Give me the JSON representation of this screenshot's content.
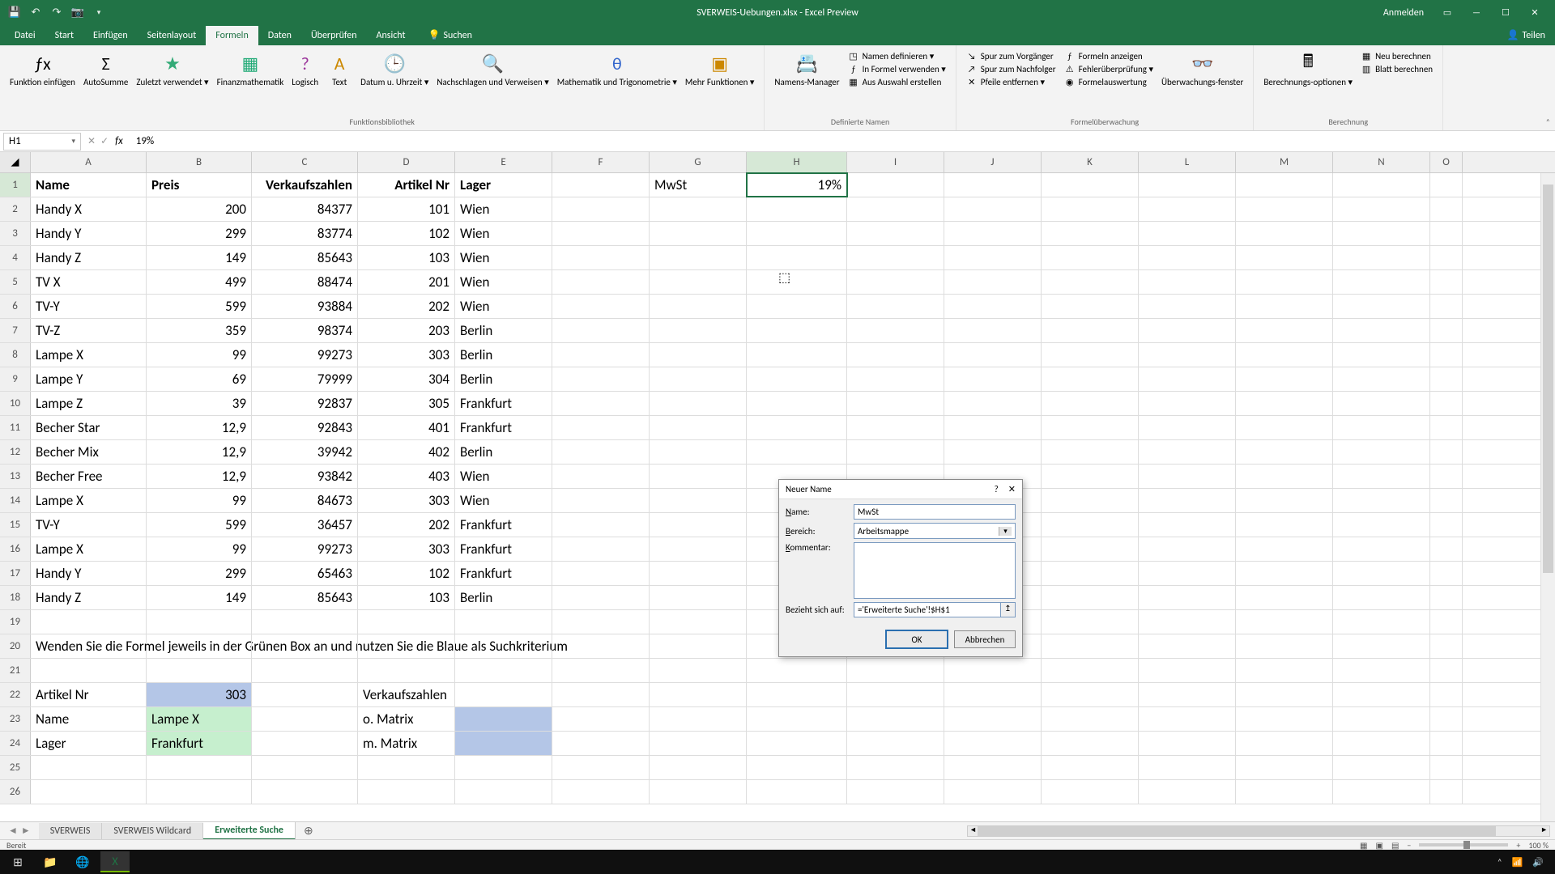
{
  "titlebar": {
    "title": "SVERWEIS-Uebungen.xlsx - Excel Preview",
    "signin": "Anmelden"
  },
  "menu": {
    "tabs": [
      "Datei",
      "Start",
      "Einfügen",
      "Seitenlayout",
      "Formeln",
      "Daten",
      "Überprüfen",
      "Ansicht"
    ],
    "search_placeholder": "Suchen",
    "share": "Teilen"
  },
  "ribbon": {
    "groups": {
      "funcbib": {
        "label": "Funktionsbibliothek",
        "buttons": [
          "Funktion einfügen",
          "AutoSumme",
          "Zuletzt verwendet ▾",
          "Finanzmathematik",
          "Logisch",
          "Text",
          "Datum u. Uhrzeit ▾",
          "Nachschlagen und Verweisen ▾",
          "Mathematik und Trigonometrie ▾",
          "Mehr Funktionen ▾"
        ]
      },
      "defnames": {
        "label": "Definierte Namen",
        "big": "Namens-Manager",
        "items": [
          "Namen definieren ▾",
          "In Formel verwenden ▾",
          "Aus Auswahl erstellen"
        ]
      },
      "audit": {
        "label": "Formelüberwachung",
        "items_left": [
          "Spur zum Vorgänger",
          "Spur zum Nachfolger",
          "Pfeile entfernen ▾"
        ],
        "items_right": [
          "Formeln anzeigen",
          "Fehlerüberprüfung ▾",
          "Formelauswertung"
        ],
        "watch": "Überwachungs-fenster"
      },
      "calc": {
        "label": "Berechnung",
        "big": "Berechnungs-optionen ▾",
        "items": [
          "Neu berechnen",
          "Blatt berechnen"
        ]
      }
    }
  },
  "formula_bar": {
    "namebox": "H1",
    "formula": "19%"
  },
  "columns": [
    "A",
    "B",
    "C",
    "D",
    "E",
    "F",
    "G",
    "H",
    "I",
    "J",
    "K",
    "L",
    "M",
    "N",
    "O"
  ],
  "headers": {
    "A": "Name",
    "B": "Preis",
    "C": "Verkaufszahlen",
    "D": "Artikel Nr",
    "E": "Lager",
    "G": "MwSt",
    "H": "19%"
  },
  "data_rows": [
    {
      "A": "Handy X",
      "B": "200",
      "C": "84377",
      "D": "101",
      "E": "Wien"
    },
    {
      "A": "Handy Y",
      "B": "299",
      "C": "83774",
      "D": "102",
      "E": "Wien"
    },
    {
      "A": "Handy Z",
      "B": "149",
      "C": "85643",
      "D": "103",
      "E": "Wien"
    },
    {
      "A": "TV X",
      "B": "499",
      "C": "88474",
      "D": "201",
      "E": "Wien"
    },
    {
      "A": "TV-Y",
      "B": "599",
      "C": "93884",
      "D": "202",
      "E": "Wien"
    },
    {
      "A": "TV-Z",
      "B": "359",
      "C": "98374",
      "D": "203",
      "E": "Berlin"
    },
    {
      "A": "Lampe X",
      "B": "99",
      "C": "99273",
      "D": "303",
      "E": "Berlin"
    },
    {
      "A": "Lampe Y",
      "B": "69",
      "C": "79999",
      "D": "304",
      "E": "Berlin"
    },
    {
      "A": "Lampe Z",
      "B": "39",
      "C": "92837",
      "D": "305",
      "E": "Frankfurt"
    },
    {
      "A": "Becher Star",
      "B": "12,9",
      "C": "92843",
      "D": "401",
      "E": "Frankfurt"
    },
    {
      "A": "Becher Mix",
      "B": "12,9",
      "C": "39942",
      "D": "402",
      "E": "Berlin"
    },
    {
      "A": "Becher Free",
      "B": "12,9",
      "C": "93842",
      "D": "403",
      "E": "Wien"
    },
    {
      "A": "Lampe X",
      "B": "99",
      "C": "84673",
      "D": "303",
      "E": "Wien"
    },
    {
      "A": "TV-Y",
      "B": "599",
      "C": "36457",
      "D": "202",
      "E": "Frankfurt"
    },
    {
      "A": "Lampe X",
      "B": "99",
      "C": "99273",
      "D": "303",
      "E": "Frankfurt"
    },
    {
      "A": "Handy Y",
      "B": "299",
      "C": "65463",
      "D": "102",
      "E": "Frankfurt"
    },
    {
      "A": "Handy Z",
      "B": "149",
      "C": "85643",
      "D": "103",
      "E": "Berlin"
    }
  ],
  "row20": "Wenden Sie die Formel jeweils in der Grünen Box an und nutzen Sie die Blaue als Suchkriterium",
  "lookup": {
    "r22": {
      "A": "Artikel Nr",
      "B": "303",
      "D": "Verkaufszahlen"
    },
    "r23": {
      "A": "Name",
      "B": "Lampe X",
      "D": "o. Matrix"
    },
    "r24": {
      "A": "Lager",
      "B": "Frankfurt",
      "D": "m. Matrix"
    }
  },
  "sheets": [
    "SVERWEIS",
    "SVERWEIS Wildcard",
    "Erweiterte Suche"
  ],
  "status": {
    "ready": "Bereit",
    "zoom": "100 %"
  },
  "dialog": {
    "title": "Neuer Name",
    "name_label": "Name:",
    "name_value": "MwSt",
    "scope_label": "Bereich:",
    "scope_value": "Arbeitsmappe",
    "comment_label": "Kommentar:",
    "refersto_label": "Bezieht sich auf:",
    "refersto_value": "='Erweiterte Suche'!$H$1",
    "ok": "OK",
    "cancel": "Abbrechen"
  },
  "taskbar": {
    "time": ""
  }
}
